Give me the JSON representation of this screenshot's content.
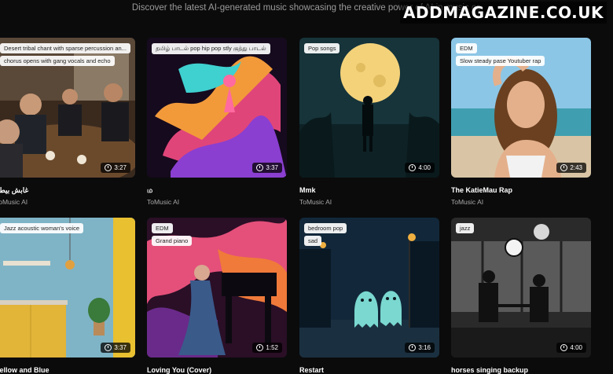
{
  "header": {
    "subtitle": "Discover the latest AI-generated music showcasing the creative power of AI in music co"
  },
  "watermark": "ADDMAGAZINE.CO.UK",
  "cards": [
    {
      "tags": [
        "Desert tribal chant with sparse percussion an...",
        "chorus opens with gang vocals and echo"
      ],
      "duration": "3:27",
      "title": "غابش بيطلـ",
      "author": "ToMusic AI"
    },
    {
      "tags": [
        "தமிழ் பாடல் pop hip pop stly குத்து பாடல்"
      ],
      "duration": "3:37",
      "title": "ம",
      "author": "ToMusic AI"
    },
    {
      "tags": [
        "Pop songs"
      ],
      "duration": "4:00",
      "title": "Mmk",
      "author": "ToMusic AI"
    },
    {
      "tags": [
        "EDM",
        "Slow steady pase Youtuber rap"
      ],
      "duration": "2:43",
      "title": "The KatieMau Rap",
      "author": "ToMusic AI"
    },
    {
      "tags": [
        "Jazz acoustic woman's voice"
      ],
      "duration": "3:37",
      "title": "Yellow and Blue",
      "author": ""
    },
    {
      "tags": [
        "EDM",
        "Grand piano"
      ],
      "duration": "1:52",
      "title": "Loving You (Cover)",
      "author": ""
    },
    {
      "tags": [
        "bedroom pop",
        "sad"
      ],
      "duration": "3:16",
      "title": "Restart",
      "author": ""
    },
    {
      "tags": [
        "jazz"
      ],
      "duration": "4:00",
      "title": "horses singing backup",
      "author": ""
    }
  ]
}
